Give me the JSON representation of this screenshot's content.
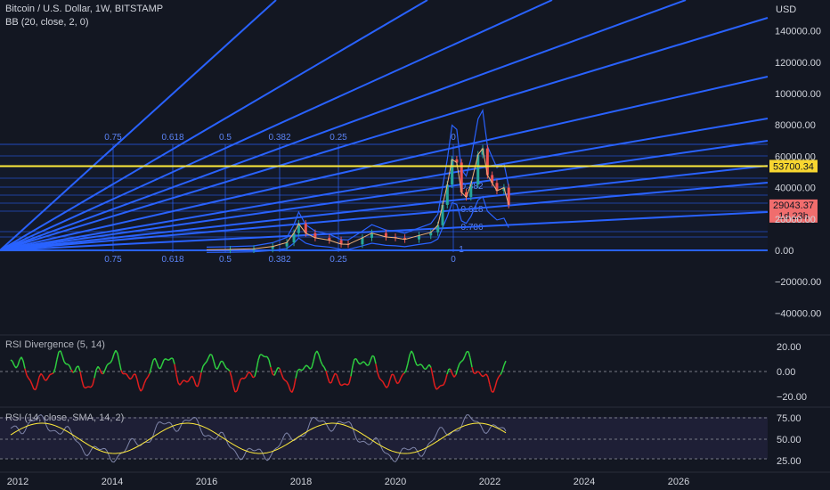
{
  "header": {
    "symbol": "Bitcoin / U.S. Dollar, 1W, BITSTAMP",
    "indicator": "BB (20, close, 2, 0)",
    "currency": "USD"
  },
  "price_axis": {
    "ticks": [
      "140000.00",
      "120000.00",
      "100000.00",
      "80000.00",
      "60000.00",
      "40000.00",
      "20000.00",
      "0.00",
      "−20000.00",
      "−40000.00"
    ],
    "level_label": "53700.34",
    "last_price": "29043.37",
    "countdown": "1d 23h"
  },
  "fib_levels": [
    "0.75",
    "0.618",
    "0.5",
    "0.382",
    "0.25",
    "0"
  ],
  "fib_inner": [
    "0.382",
    "0.618",
    "0.786",
    "1"
  ],
  "rsi_div": {
    "title": "RSI Divergence (5, 14)",
    "ticks": [
      "20.00",
      "0.00",
      "−20.00"
    ]
  },
  "rsi": {
    "title": "RSI (14, close, SMA, 14, 2)",
    "ticks": [
      "75.00",
      "50.00",
      "25.00"
    ]
  },
  "time_axis": {
    "ticks": [
      "2012",
      "2014",
      "2016",
      "2018",
      "2020",
      "2022",
      "2024",
      "2026"
    ]
  },
  "colors": {
    "background": "#131722",
    "fan": "#2962ff",
    "level": "#ffeb3b",
    "candle_up": "#26a69a",
    "candle_down": "#ef5350",
    "rsi_line": "#7e84a8",
    "rsi_ma": "#ffeb3b",
    "level_badge": "#f7d630",
    "price_badge": "#f06d6d"
  },
  "chart_data": {
    "type": "line",
    "x_range": [
      2012,
      2028
    ],
    "ylim": [
      -50000,
      150000
    ],
    "horizontal_level": 53700.34,
    "last_price": 29043.37,
    "series": [
      {
        "name": "",
        "x": [
          2016.0,
          2016.5,
          2017.0,
          2017.4,
          2017.7,
          2017.85,
          2017.95,
          2018.1,
          2018.3,
          2018.6,
          2018.85,
          2019.0,
          2019.3,
          2019.5,
          2019.8,
          2020.0,
          2020.2,
          2020.5,
          2020.75,
          2020.9,
          2021.0,
          2021.1,
          2021.2,
          2021.3,
          2021.4,
          2021.5,
          2021.6,
          2021.75,
          2021.85,
          2021.95,
          2022.05,
          2022.15,
          2022.3,
          2022.4
        ],
        "values": [
          400,
          600,
          1000,
          2500,
          5000,
          11000,
          17000,
          11000,
          8000,
          6500,
          4000,
          3800,
          8000,
          11000,
          8500,
          8000,
          7000,
          9500,
          11500,
          16000,
          29000,
          42000,
          58000,
          56000,
          37000,
          34000,
          42000,
          61000,
          65000,
          48000,
          43000,
          38000,
          40000,
          29043
        ]
      }
    ]
  }
}
